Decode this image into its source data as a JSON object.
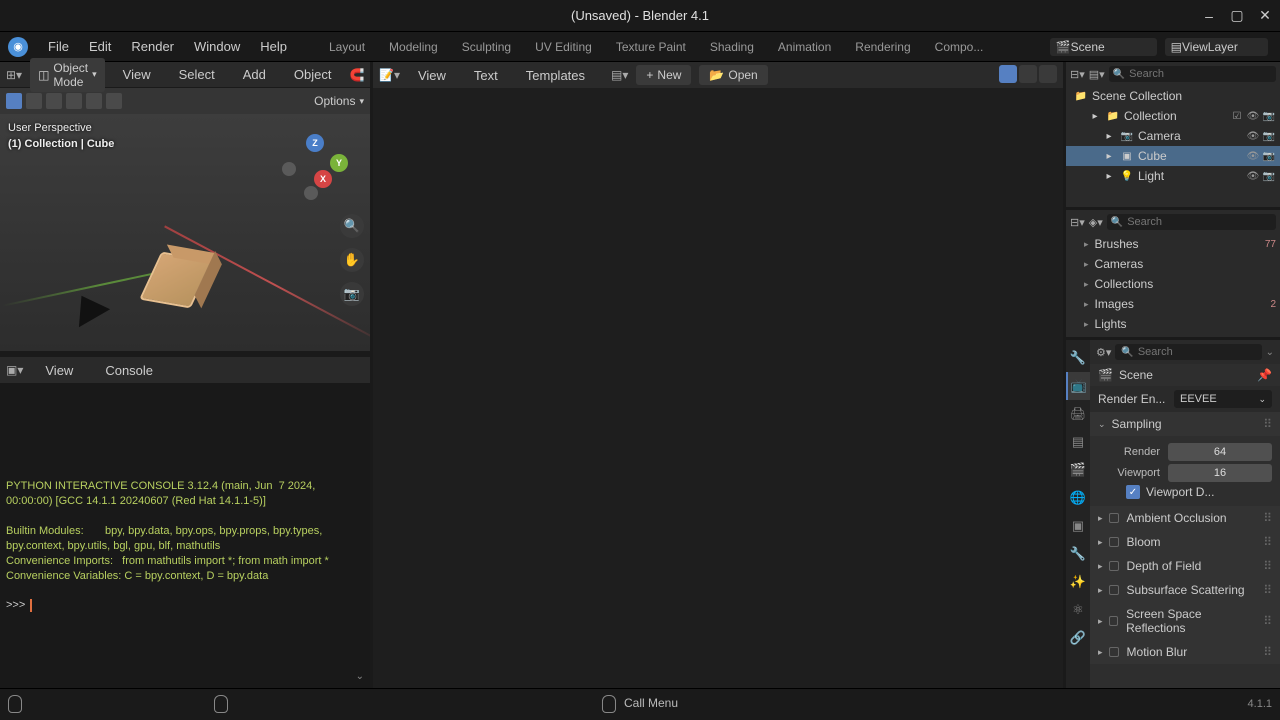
{
  "title": "(Unsaved) - Blender 4.1",
  "menubar": [
    "File",
    "Edit",
    "Render",
    "Window",
    "Help"
  ],
  "top_tabs": [
    "Layout",
    "Modeling",
    "Sculpting",
    "UV Editing",
    "Texture Paint",
    "Shading",
    "Animation",
    "Rendering",
    "Compo..."
  ],
  "scene_field": "Scene",
  "viewlayer_field": "ViewLayer",
  "viewport": {
    "mode": "Object Mode",
    "menus": [
      "View",
      "Select",
      "Add",
      "Object"
    ],
    "options_label": "Options",
    "info1": "User Perspective",
    "info2": "(1) Collection | Cube",
    "gizmo": {
      "x": "X",
      "y": "Y",
      "z": "Z"
    }
  },
  "console": {
    "menus": [
      "View",
      "Console"
    ],
    "body": "PYTHON INTERACTIVE CONSOLE 3.12.4 (main, Jun  7 2024, 00:00:00) [GCC 14.1.1 20240607 (Red Hat 14.1.1-5)]\n\nBuiltin Modules:       bpy, bpy.data, bpy.ops, bpy.props, bpy.types, bpy.context, bpy.utils, bgl, gpu, blf, mathutils\nConvenience Imports:   from mathutils import *; from math import *\nConvenience Variables: C = bpy.context, D = bpy.data\n",
    "prompt": ">>> "
  },
  "text_editor": {
    "menus": [
      "View",
      "Text",
      "Templates"
    ],
    "new": "New",
    "open": "Open"
  },
  "outliner": {
    "search_ph": "Search",
    "items": [
      {
        "label": "Scene Collection",
        "indent": 0,
        "icon": "📁",
        "eye": false
      },
      {
        "label": "Collection",
        "indent": 1,
        "icon": "📁",
        "eye": true,
        "check": true
      },
      {
        "label": "Camera",
        "indent": 2,
        "icon": "📷",
        "eye": true
      },
      {
        "label": "Cube",
        "indent": 2,
        "icon": "▣",
        "eye": true,
        "sel": true
      },
      {
        "label": "Light",
        "indent": 2,
        "icon": "💡",
        "eye": true
      }
    ]
  },
  "databrowser": {
    "search_ph": "Search",
    "items": [
      {
        "label": "Brushes",
        "badge": "77"
      },
      {
        "label": "Cameras"
      },
      {
        "label": "Collections"
      },
      {
        "label": "Images",
        "badge": "2"
      },
      {
        "label": "Lights"
      }
    ]
  },
  "properties": {
    "search_ph": "Search",
    "scene_label": "Scene",
    "render_engine_label": "Render En...",
    "render_engine_value": "EEVEE",
    "sampling": {
      "head": "Sampling",
      "render_label": "Render",
      "render_value": "64",
      "viewport_label": "Viewport",
      "viewport_value": "16",
      "viewport_denoise": "Viewport D..."
    },
    "sections": [
      "Ambient Occlusion",
      "Bloom",
      "Depth of Field",
      "Subsurface Scattering",
      "Screen Space Reflections",
      "Motion Blur"
    ]
  },
  "statusbar": {
    "call_menu": "Call Menu",
    "version": "4.1.1"
  }
}
